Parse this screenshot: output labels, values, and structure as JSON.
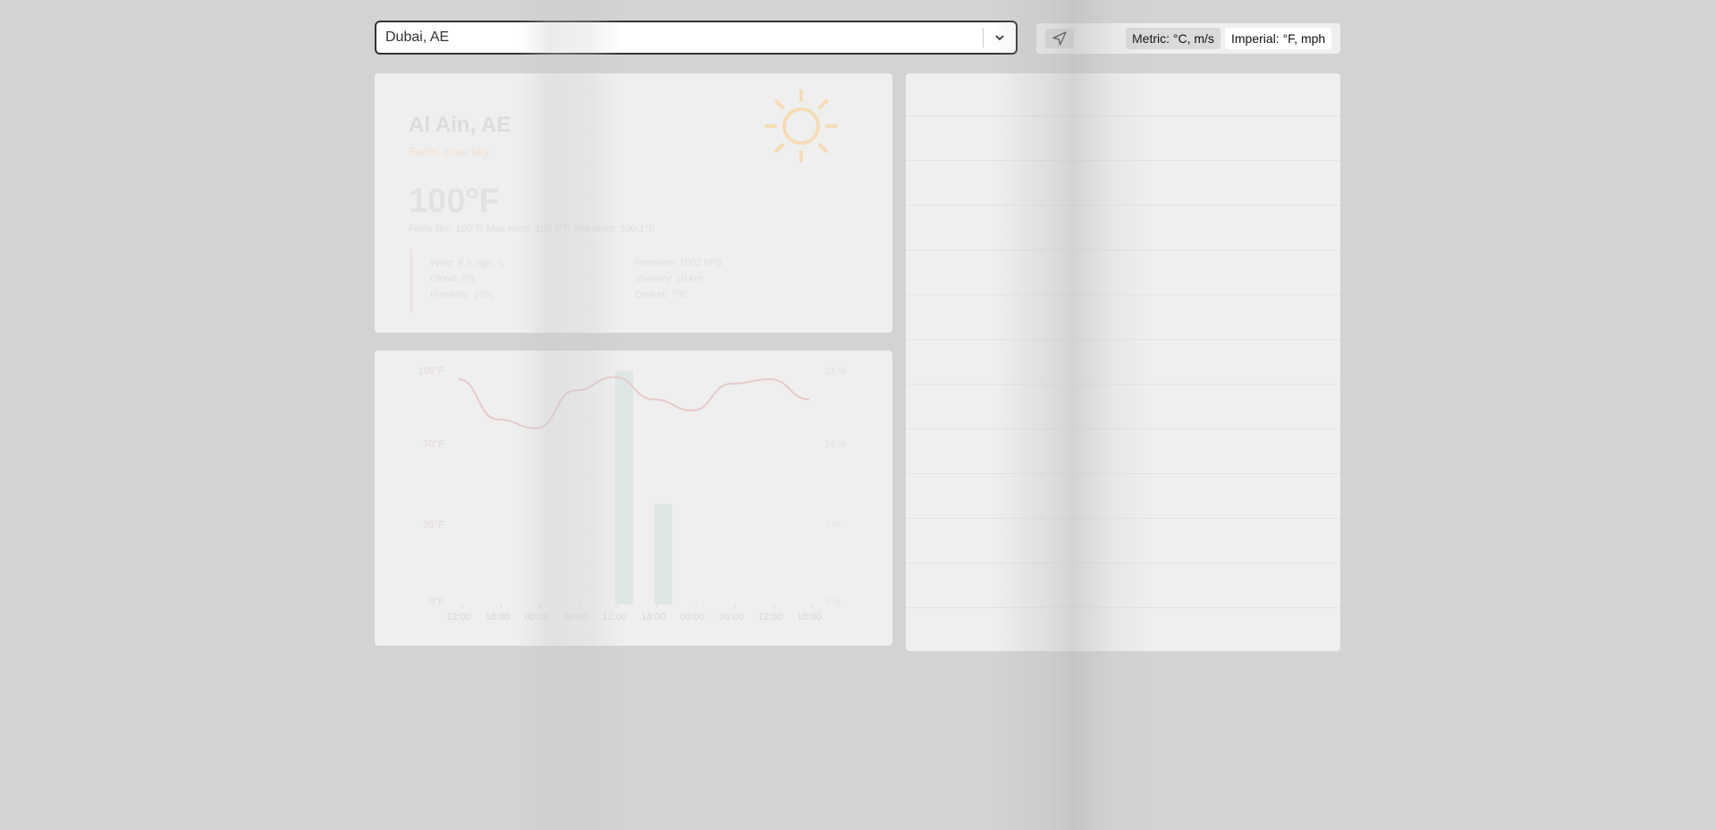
{
  "search": {
    "value": "Dubai, AE"
  },
  "units": {
    "metric_label": "Metric: °C, m/s",
    "imperial_label": "Imperial: °F, mph",
    "selected": "imperial"
  },
  "current": {
    "city": "Al Ain, AE",
    "description": "Feels: clear sky",
    "temperature": "100°F",
    "summary": "Feels like: 100°F. Max temp: 100.3°F. Min temp: 100.1°F",
    "details": {
      "wind": "Wind: 8.3 mph ↘",
      "cloud": "Cloud: 0%",
      "humidity": "Humidity: 10%",
      "pressure": "Pressure: 1002 hPa",
      "visibility": "Visibility: 10 km",
      "dewpoint": "Dew pt: 7°C"
    },
    "icon": "sun-icon",
    "accent_color": "#f4c98a"
  },
  "chart_data": {
    "type": "line",
    "x": [
      "12:00",
      "18:00",
      "00:00",
      "06:00",
      "12:00",
      "18:00",
      "00:00",
      "06:00",
      "12:00",
      "18:00"
    ],
    "series": [
      {
        "values": [
          101,
          83,
          79,
          96,
          102,
          92,
          87,
          99,
          101,
          92
        ]
      }
    ],
    "bars": [
      0,
      0,
      0,
      0,
      21,
      9,
      0,
      0,
      0,
      0
    ],
    "y_left_ticks": [
      "105°F",
      "70°F",
      "35°F",
      "0°F"
    ],
    "y_right_ticks": [
      "21 %",
      "14 %",
      "7 %",
      "0 %"
    ],
    "ylim": [
      0,
      105
    ],
    "y2lim": [
      0,
      21
    ],
    "line_color": "#e8caca",
    "bar_color": "#dfe6e6"
  },
  "forecast": {
    "rows": 13
  }
}
